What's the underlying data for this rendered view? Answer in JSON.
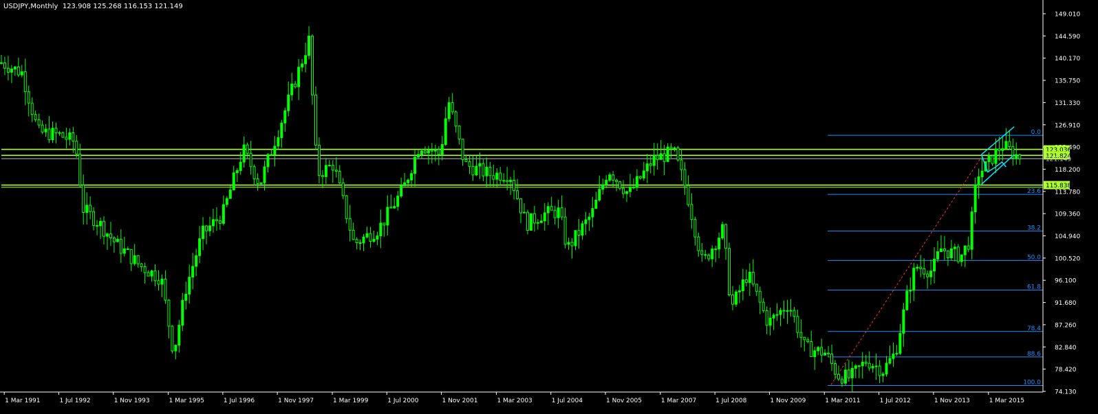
{
  "header": {
    "symbol": "USDJPY,Monthly",
    "ohlc": "123.908 125.268 116.153 121.149"
  },
  "chart_data": {
    "type": "candlestick",
    "symbol": "USDJPY",
    "timeframe": "Monthly",
    "ylim": [
      74.13,
      151.2
    ],
    "y_ticks": [
      "149.010",
      "144.590",
      "140.170",
      "135.750",
      "131.330",
      "126.910",
      "122.490",
      "118.200",
      "113.780",
      "109.360",
      "104.940",
      "100.520",
      "96.100",
      "91.680",
      "87.260",
      "82.840",
      "78.420",
      "74.130"
    ],
    "x_ticks": [
      {
        "label": "1 Mar 1991",
        "t": 1991.17
      },
      {
        "label": "1 Jul 1992",
        "t": 1992.5
      },
      {
        "label": "1 Nov 1993",
        "t": 1993.83
      },
      {
        "label": "1 Mar 1995",
        "t": 1995.17
      },
      {
        "label": "1 Jul 1996",
        "t": 1996.5
      },
      {
        "label": "1 Nov 1997",
        "t": 1997.83
      },
      {
        "label": "1 Mar 1999",
        "t": 1999.17
      },
      {
        "label": "1 Jul 2000",
        "t": 2000.5
      },
      {
        "label": "1 Nov 2001",
        "t": 2001.83
      },
      {
        "label": "1 Mar 2003",
        "t": 2003.17
      },
      {
        "label": "1 Jul 2004",
        "t": 2004.5
      },
      {
        "label": "1 Nov 2005",
        "t": 2005.83
      },
      {
        "label": "1 Mar 2007",
        "t": 2007.17
      },
      {
        "label": "1 Jul 2008",
        "t": 2008.5
      },
      {
        "label": "1 Nov 2009",
        "t": 2009.83
      },
      {
        "label": "1 Mar 2011",
        "t": 2011.17
      },
      {
        "label": "1 Jul 2012",
        "t": 2012.5
      },
      {
        "label": "1 Nov 2013",
        "t": 2013.83
      },
      {
        "label": "1 Mar 2015",
        "t": 2015.17
      }
    ],
    "xlim": [
      1991.1,
      2016.5
    ],
    "price_path": [
      [
        1991.1,
        140.5
      ],
      [
        1991.6,
        138.5
      ],
      [
        1992.0,
        126.5
      ],
      [
        1992.5,
        126.0
      ],
      [
        1992.9,
        124.5
      ],
      [
        1993.1,
        111.0
      ],
      [
        1993.5,
        108.0
      ],
      [
        1993.9,
        104.0
      ],
      [
        1994.5,
        99.5
      ],
      [
        1995.0,
        97.0
      ],
      [
        1995.3,
        82.0
      ],
      [
        1995.6,
        95.0
      ],
      [
        1996.0,
        106.0
      ],
      [
        1996.5,
        110.0
      ],
      [
        1997.0,
        123.0
      ],
      [
        1997.4,
        116.0
      ],
      [
        1997.9,
        128.0
      ],
      [
        1998.6,
        145.0
      ],
      [
        1998.8,
        118.0
      ],
      [
        1999.2,
        120.0
      ],
      [
        1999.7,
        104.0
      ],
      [
        2000.3,
        107.0
      ],
      [
        2000.9,
        115.0
      ],
      [
        2001.3,
        124.0
      ],
      [
        2001.8,
        122.0
      ],
      [
        2002.0,
        133.0
      ],
      [
        2002.4,
        120.0
      ],
      [
        2003.0,
        118.0
      ],
      [
        2003.5,
        118.0
      ],
      [
        2003.9,
        108.0
      ],
      [
        2004.3,
        110.0
      ],
      [
        2004.7,
        110.5
      ],
      [
        2004.9,
        103.0
      ],
      [
        2005.5,
        110.0
      ],
      [
        2005.9,
        119.0
      ],
      [
        2006.4,
        114.0
      ],
      [
        2007.0,
        121.0
      ],
      [
        2007.5,
        122.5
      ],
      [
        2007.8,
        115.0
      ],
      [
        2008.2,
        100.0
      ],
      [
        2008.7,
        107.0
      ],
      [
        2008.9,
        91.0
      ],
      [
        2009.3,
        98.0
      ],
      [
        2009.8,
        88.0
      ],
      [
        2010.3,
        92.0
      ],
      [
        2010.7,
        83.0
      ],
      [
        2011.2,
        82.0
      ],
      [
        2011.5,
        77.5
      ],
      [
        2011.8,
        77.0
      ],
      [
        2012.2,
        80.5
      ],
      [
        2012.6,
        78.5
      ],
      [
        2012.9,
        82.0
      ],
      [
        2013.2,
        94.0
      ],
      [
        2013.4,
        99.5
      ],
      [
        2013.8,
        98.5
      ],
      [
        2014.0,
        103.0
      ],
      [
        2014.5,
        101.5
      ],
      [
        2014.7,
        104.5
      ],
      [
        2014.9,
        118.0
      ],
      [
        2015.1,
        119.5
      ],
      [
        2015.5,
        124.0
      ],
      [
        2015.9,
        121.5
      ]
    ],
    "horizontal_levels": [
      {
        "price": 123.036,
        "label": "123.036",
        "color": "#adff2f",
        "tag": true
      },
      {
        "price": 121.824,
        "label": "121.824",
        "color": "#adff2f",
        "tag": true
      },
      {
        "price": 121.149,
        "label": "121.149",
        "color": "#c0c0c0",
        "tag": false
      },
      {
        "price": 115.838,
        "label": "115.838",
        "color": "#adff2f",
        "tag": true
      },
      {
        "price": 115.4,
        "label": "",
        "color": "#adff2f",
        "tag": false
      }
    ],
    "fibonacci": {
      "t_start": 2011.25,
      "color": "#1e90ff",
      "levels": [
        {
          "label": "0.0",
          "price": 125.86
        },
        {
          "label": "23.6",
          "price": 113.96
        },
        {
          "label": "38.2",
          "price": 106.6
        },
        {
          "label": "50.0",
          "price": 100.65
        },
        {
          "label": "61.8",
          "price": 94.7
        },
        {
          "label": "78.4",
          "price": 86.34
        },
        {
          "label": "88.6",
          "price": 81.2
        },
        {
          "label": "100.0",
          "price": 75.44
        }
      ],
      "trend_from": [
        2011.33,
        75.6
      ],
      "trend_to": [
        2015.0,
        121.5
      ]
    },
    "channel": {
      "color": "#00e5ff",
      "upper": [
        [
          2015.0,
          122.0
        ],
        [
          2015.8,
          127.6
        ]
      ],
      "lower": [
        [
          2015.0,
          116.0
        ],
        [
          2015.8,
          122.0
        ]
      ],
      "inner": [
        [
          2015.0,
          122.0
        ],
        [
          2015.15,
          118.5
        ],
        [
          2015.35,
          119.5
        ],
        [
          2015.5,
          120.5
        ],
        [
          2015.6,
          119.5
        ]
      ]
    },
    "colors": {
      "background": "#000000",
      "candle": "#00ff00",
      "axis": "#ffffff",
      "text": "#ffffff"
    }
  }
}
